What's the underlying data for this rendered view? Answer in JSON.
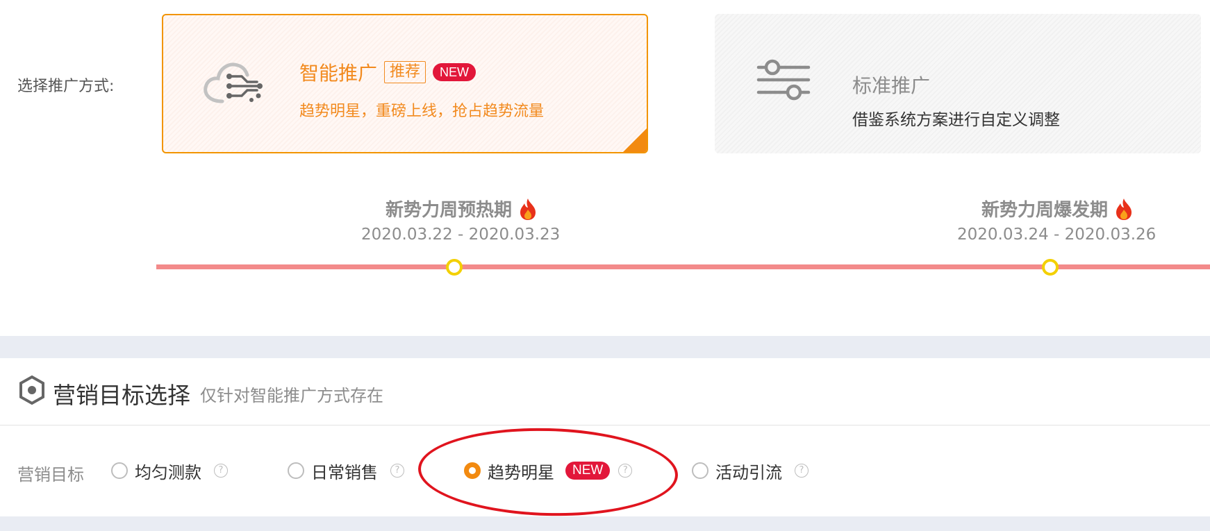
{
  "promotion": {
    "label": "选择推广方式:",
    "smart": {
      "title": "智能推广",
      "tag_recommend": "推荐",
      "tag_new": "NEW",
      "description": "趋势明星，重磅上线，抢占趋势流量",
      "icon": "cloud-network-icon",
      "selected": true
    },
    "standard": {
      "title": "标准推广",
      "description": "借鉴系统方案进行自定义调整",
      "icon": "sliders-icon"
    }
  },
  "timeline": {
    "phases": [
      {
        "title": "新势力周预热期",
        "dates": "2020.03.22 - 2020.03.23",
        "icon": "fire-icon"
      },
      {
        "title": "新势力周爆发期",
        "dates": "2020.03.24 - 2020.03.26",
        "icon": "fire-icon"
      }
    ]
  },
  "marketing": {
    "section_title": "营销目标选择",
    "section_subtitle": "仅针对智能推广方式存在",
    "goal_label": "营销目标",
    "options": [
      {
        "label": "均匀测款",
        "checked": false
      },
      {
        "label": "日常销售",
        "checked": false
      },
      {
        "label": "趋势明星",
        "checked": true,
        "badge": "NEW"
      },
      {
        "label": "活动引流",
        "checked": false
      }
    ],
    "help_glyph": "?"
  },
  "colors": {
    "accent": "#f28a1e",
    "new_badge": "#e2173a",
    "timeline": "#f38a8a",
    "node": "#f3d000",
    "annotation": "#e0141e"
  }
}
